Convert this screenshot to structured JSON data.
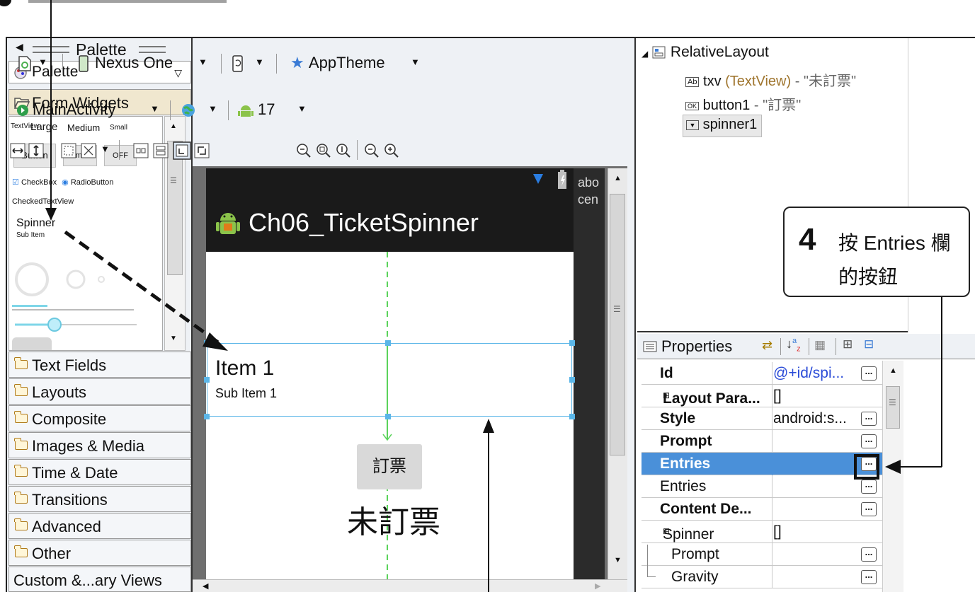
{
  "palette": {
    "title": "Palette",
    "selector": "Palette",
    "open_folder": "Form Widgets",
    "widgets": {
      "textview_row": [
        "TextView",
        "Large",
        "Medium",
        "Small"
      ],
      "buttons": [
        "Button",
        "Small",
        "OFF"
      ],
      "checkbox": "CheckBox",
      "radio": "RadioButton",
      "checked_textview": "CheckedTextView",
      "spinner": "Spinner",
      "sub_item": "Sub Item"
    },
    "folders": [
      "Text Fields",
      "Layouts",
      "Composite",
      "Images & Media",
      "Time & Date",
      "Transitions",
      "Advanced",
      "Other"
    ],
    "last_folder": "Custom &...ary Views"
  },
  "toolbar": {
    "device": "Nexus One",
    "theme": "AppTheme",
    "activity": "MainActivity",
    "api_level": "17"
  },
  "device": {
    "status_overflow": [
      "abo",
      "cen"
    ],
    "app_title": "Ch06_TicketSpinner",
    "spinner_item": "Item 1",
    "spinner_sub_item": "Sub Item 1",
    "button_text": "訂票",
    "status_text": "未訂票"
  },
  "outline": {
    "root": "RelativeLayout",
    "items": [
      {
        "id": "txv",
        "type": " (TextView)",
        "text": " - \"未訂票\""
      },
      {
        "id": "button1",
        "type": "",
        "text": " - \"訂票\""
      },
      {
        "id": "spinner1",
        "type": "",
        "text": ""
      }
    ]
  },
  "properties": {
    "title": "Properties",
    "rows": [
      {
        "name": "Id",
        "value": "@+id/spi...",
        "has_button": true
      },
      {
        "name": "Layout Para...",
        "value": "[]",
        "has_button": false
      },
      {
        "name": "Style",
        "value": "android:s...",
        "has_button": true
      },
      {
        "name": "Prompt",
        "value": "",
        "has_button": true
      },
      {
        "name": "Entries",
        "value": "",
        "has_button": true
      },
      {
        "name": "Entries",
        "value": "",
        "has_button": true
      },
      {
        "name": "Content De...",
        "value": "",
        "has_button": true
      },
      {
        "name": "Spinner",
        "value": "[]",
        "has_button": false
      },
      {
        "name": "Prompt",
        "value": "",
        "has_button": true
      },
      {
        "name": "Gravity",
        "value": "",
        "has_button": true
      }
    ]
  },
  "callout": {
    "step": "4",
    "line1": "按 Entries 欄",
    "line2": "的按鈕"
  },
  "colors": {
    "selection": "#4a90d9",
    "guide": "#5bd35b",
    "android_green": "#8bc34a"
  }
}
